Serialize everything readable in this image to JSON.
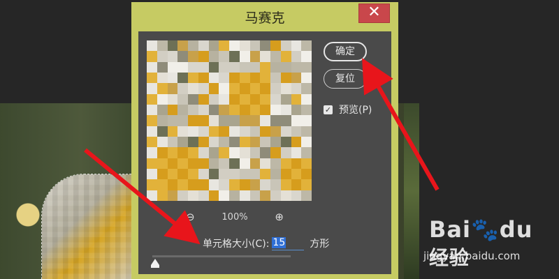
{
  "dialog": {
    "title": "马赛克",
    "close_label": "✕",
    "ok_label": "确定",
    "reset_label": "复位",
    "preview_label": "预览(P)",
    "preview_checked": true,
    "zoom_level": "100%",
    "cell_size_label": "单元格大小(C):",
    "cell_size_value": "15",
    "cell_size_unit": "方形",
    "slider_level": 0.02
  },
  "icons": {
    "zoom_out": "zoom-out-icon",
    "zoom_in": "zoom-in-icon",
    "check": "checkmark-icon"
  },
  "colors": {
    "dialog_frame": "#c6cb63",
    "dialog_body": "#4a4a4a",
    "close_button": "#c9474b",
    "annotation_arrow": "#e8151b",
    "selection_highlight": "#2f6fd6"
  },
  "watermark": {
    "logo_text": "Bai",
    "logo_mark": "du",
    "logo_cn": "经验",
    "url": "jingyan.baidu.com"
  }
}
